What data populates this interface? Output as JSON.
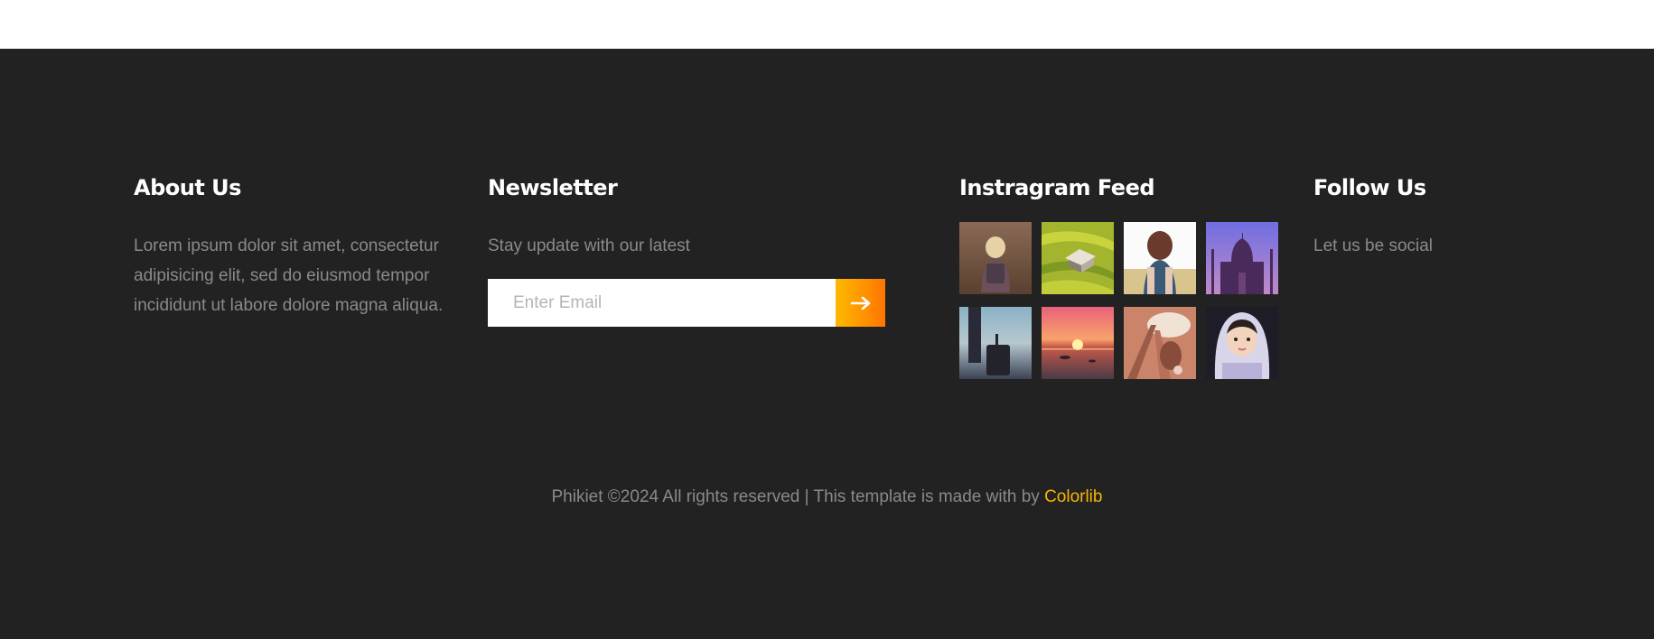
{
  "about": {
    "title": "About Us",
    "text": "Lorem ipsum dolor sit amet, consectetur adipisicing elit, sed do eiusmod tempor incididunt ut labore dolore magna aliqua."
  },
  "newsletter": {
    "title": "Newsletter",
    "text": "Stay update with our latest",
    "email_placeholder": "Enter Email",
    "submit_icon": "arrow-right-icon"
  },
  "instagram": {
    "title": "Instragram Feed",
    "images": [
      "child-walking-photo",
      "hut-on-rice-field-photo",
      "woman-in-field-photo",
      "taj-mahal-dusk-photo",
      "person-with-suitcase-photo",
      "sunset-over-sea-photo",
      "person-on-rail-track-photo",
      "child-in-hood-photo"
    ]
  },
  "follow": {
    "title": "Follow Us",
    "text": "Let us be social"
  },
  "copyright": {
    "text": "Phikiet ©2024 All rights reserved | This template is made with  by ",
    "link_label": "Colorlib"
  },
  "colors": {
    "footer_bg": "#222222",
    "heading": "#ffffff",
    "body_text": "#8a8a8a",
    "accent_link": "#f7b600",
    "button_gradient_start": "#ffb900",
    "button_gradient_end": "#ff7500"
  }
}
